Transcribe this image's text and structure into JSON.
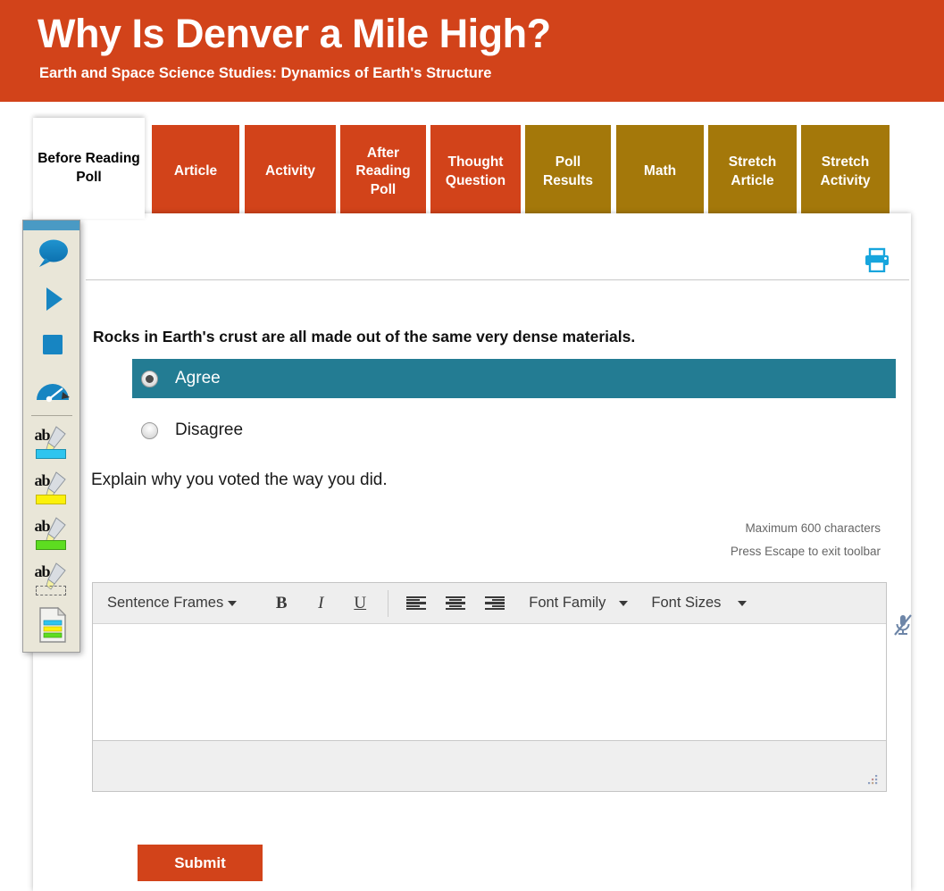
{
  "banner": {
    "title": "Why Is Denver a Mile High?",
    "subtitle": "Earth and Space Science Studies: Dynamics of Earth's Structure",
    "bg_color": "#d2431a"
  },
  "tabs": [
    {
      "label": "Before Reading Poll",
      "state": "active",
      "color": "#ffffff"
    },
    {
      "label": "Article",
      "state": "inactive",
      "color": "#d2431a"
    },
    {
      "label": "Activity",
      "state": "inactive",
      "color": "#d2431a"
    },
    {
      "label": "After Reading Poll",
      "state": "inactive",
      "color": "#d2431a"
    },
    {
      "label": "Thought Question",
      "state": "inactive",
      "color": "#d2431a"
    },
    {
      "label": "Poll Results",
      "state": "inactive",
      "color": "#a4780a"
    },
    {
      "label": "Math",
      "state": "inactive",
      "color": "#a4780a"
    },
    {
      "label": "Stretch Article",
      "state": "inactive",
      "color": "#a4780a"
    },
    {
      "label": "Stretch Activity",
      "state": "inactive",
      "color": "#a4780a"
    }
  ],
  "poll": {
    "question": "Rocks in Earth's crust are all made out of the same very dense materials.",
    "options": [
      {
        "label": "Agree",
        "selected": true
      },
      {
        "label": "Disagree",
        "selected": false
      }
    ],
    "selected_color": "#237c93",
    "explain_prompt": "Explain why you voted the way you did.",
    "max_chars_hint": "Maximum 600 characters",
    "escape_hint": "Press Escape to exit toolbar"
  },
  "editor": {
    "sentence_frames_label": "Sentence Frames",
    "bold_label": "B",
    "italic_label": "I",
    "underline_label": "U",
    "font_family_label": "Font Family",
    "font_sizes_label": "Font Sizes",
    "content": ""
  },
  "actions": {
    "submit_label": "Submit",
    "submit_color": "#d2431a"
  },
  "icons": {
    "print": "print-icon",
    "microphone": "microphone-muted-icon",
    "resize": "resize-grip-icon"
  },
  "tts_toolbar": {
    "tools": [
      {
        "name": "speech-bubble-icon",
        "color": "#1b87c4"
      },
      {
        "name": "play-icon",
        "color": "#1b87c4"
      },
      {
        "name": "stop-icon",
        "color": "#1b87c4"
      },
      {
        "name": "speed-gauge-icon",
        "color": "#1b87c4"
      },
      {
        "name": "highlighter-cyan-icon",
        "color": "#2ec5ef"
      },
      {
        "name": "highlighter-yellow-icon",
        "color": "#fbf10a"
      },
      {
        "name": "highlighter-green-icon",
        "color": "#5ddd20"
      },
      {
        "name": "highlighter-clear-icon",
        "color": "#ffffff"
      },
      {
        "name": "collect-highlights-icon",
        "color": "#e9e6d8"
      }
    ]
  }
}
